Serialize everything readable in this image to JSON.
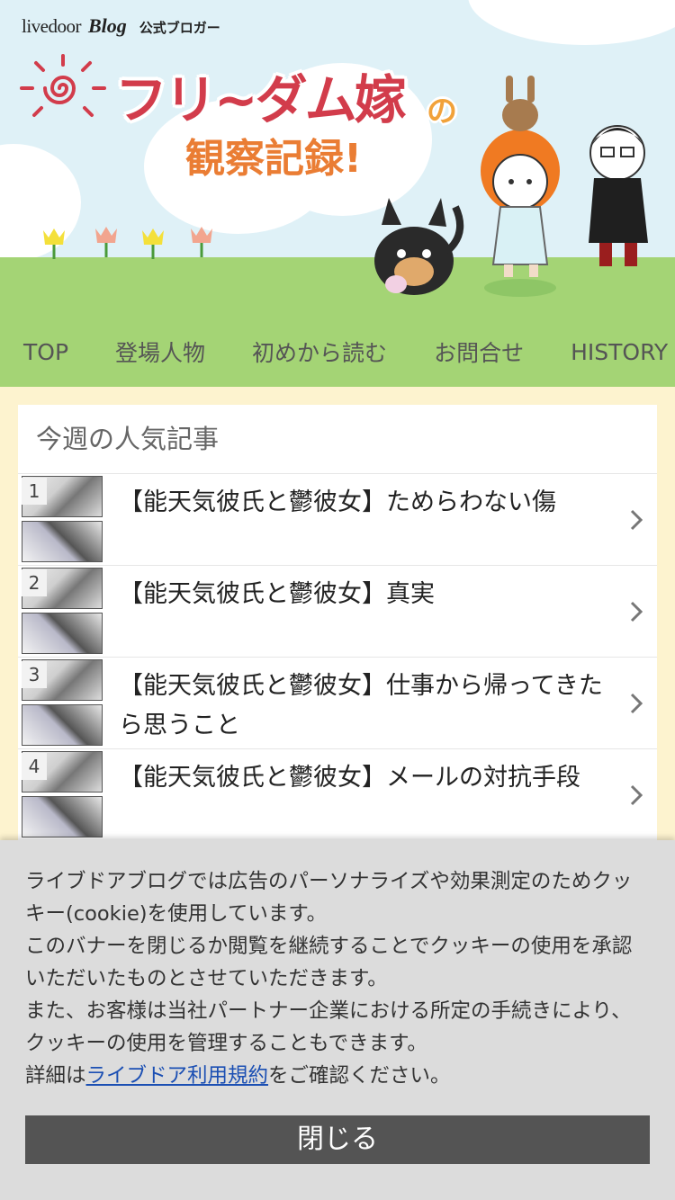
{
  "header": {
    "logo_livedoor": "livedoor",
    "logo_blog": "Blog",
    "logo_official": "公式ブロガー",
    "title_main": "フリ~ダム嫁",
    "title_no": "の",
    "title_sub": "観察記録!"
  },
  "nav": {
    "items": [
      "TOP",
      "登場人物",
      "初めから読む",
      "お問合せ",
      "HISTORY"
    ]
  },
  "popular": {
    "heading": "今週の人気記事",
    "items": [
      {
        "rank": "1",
        "title": "【能天気彼氏と鬱彼女】ためらわない傷"
      },
      {
        "rank": "2",
        "title": "【能天気彼氏と鬱彼女】真実"
      },
      {
        "rank": "3",
        "title": "【能天気彼氏と鬱彼女】仕事から帰ってきたら思うこと"
      },
      {
        "rank": "4",
        "title": "【能天気彼氏と鬱彼女】メールの対抗手段"
      }
    ]
  },
  "cookie": {
    "line1": "ライブドアブログでは広告のパーソナライズや効果測定のためクッキー(cookie)を使用しています。",
    "line2": "このバナーを閉じるか閲覧を継続することでクッキーの使用を承認いただいたものとさせていただきます。",
    "line3": "また、お客様は当社パートナー企業における所定の手続きにより、クッキーの使用を管理することもできます。",
    "line4_prefix": "詳細は",
    "line4_link": "ライブドア利用規約",
    "line4_suffix": "をご確認ください。",
    "close_label": "閉じる"
  },
  "colors": {
    "nav_bg": "#a4d475",
    "page_bg": "#fdf3cf",
    "title_red": "#d23c4b",
    "title_orange": "#ea7d34",
    "button_bg": "#545454",
    "link": "#1b4fb3"
  }
}
